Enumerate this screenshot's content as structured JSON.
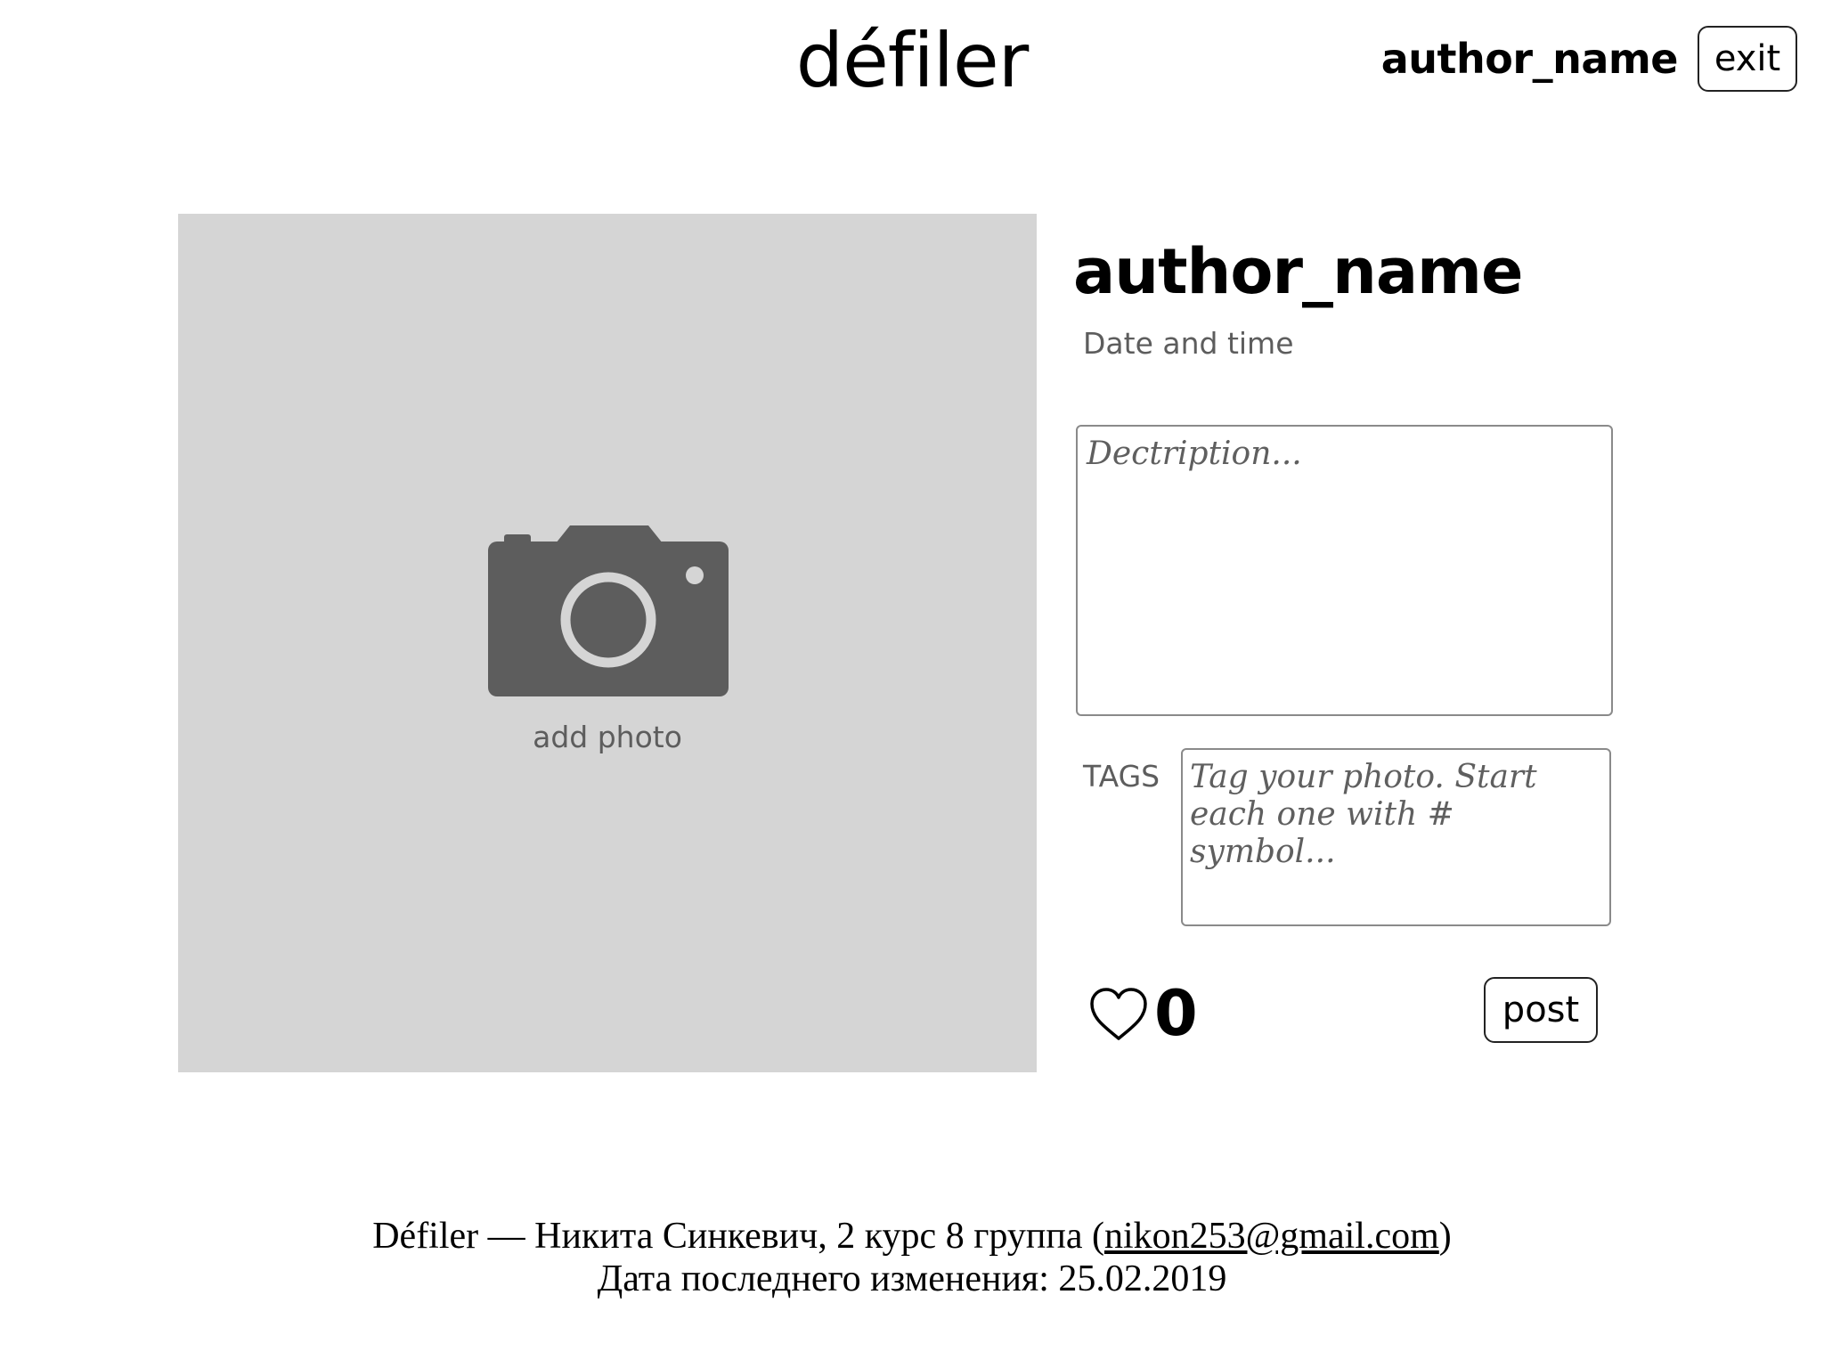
{
  "header": {
    "logo": "défiler",
    "username": "author_name",
    "exit_label": "exit"
  },
  "photo": {
    "add_label": "add photo",
    "icon": "camera-icon"
  },
  "post": {
    "author": "author_name",
    "datetime": "Date and time",
    "description_placeholder": "Dectription...",
    "tags_label": "TAGS",
    "tags_placeholder": "Tag your photo. Start each one with # symbol...",
    "like_icon": "heart-icon",
    "likes": "0",
    "post_label": "post"
  },
  "footer": {
    "line1_prefix": "Défiler — Никита Синкевич, 2 курс 8 группа (",
    "email": "nikon253@gmail.com",
    "line1_suffix": ")",
    "line2": "Дата последнего изменения: 25.02.2019"
  },
  "colors": {
    "photo_bg": "#d5d5d5",
    "icon_gray": "#5d5d5d",
    "text": "#000000"
  }
}
